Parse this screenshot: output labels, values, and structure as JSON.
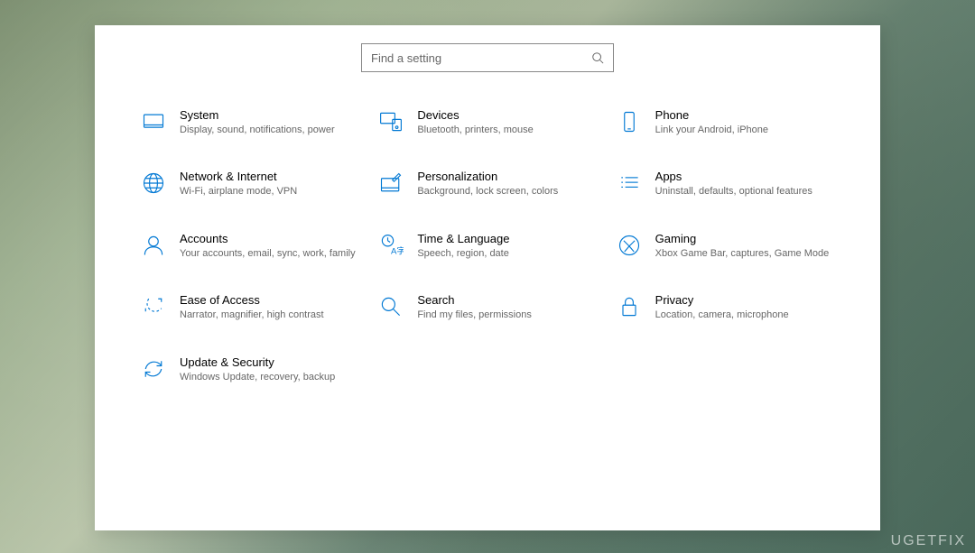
{
  "search": {
    "placeholder": "Find a setting"
  },
  "categories": [
    {
      "id": "system",
      "title": "System",
      "desc": "Display, sound, notifications, power"
    },
    {
      "id": "devices",
      "title": "Devices",
      "desc": "Bluetooth, printers, mouse"
    },
    {
      "id": "phone",
      "title": "Phone",
      "desc": "Link your Android, iPhone"
    },
    {
      "id": "network",
      "title": "Network & Internet",
      "desc": "Wi-Fi, airplane mode, VPN"
    },
    {
      "id": "personalization",
      "title": "Personalization",
      "desc": "Background, lock screen, colors"
    },
    {
      "id": "apps",
      "title": "Apps",
      "desc": "Uninstall, defaults, optional features"
    },
    {
      "id": "accounts",
      "title": "Accounts",
      "desc": "Your accounts, email, sync, work, family"
    },
    {
      "id": "time",
      "title": "Time & Language",
      "desc": "Speech, region, date"
    },
    {
      "id": "gaming",
      "title": "Gaming",
      "desc": "Xbox Game Bar, captures, Game Mode"
    },
    {
      "id": "ease",
      "title": "Ease of Access",
      "desc": "Narrator, magnifier, high contrast"
    },
    {
      "id": "search-cat",
      "title": "Search",
      "desc": "Find my files, permissions"
    },
    {
      "id": "privacy",
      "title": "Privacy",
      "desc": "Location, camera, microphone"
    },
    {
      "id": "update",
      "title": "Update & Security",
      "desc": "Windows Update, recovery, backup"
    }
  ],
  "watermark": "UGETFIX",
  "accent_color": "#0078d4"
}
